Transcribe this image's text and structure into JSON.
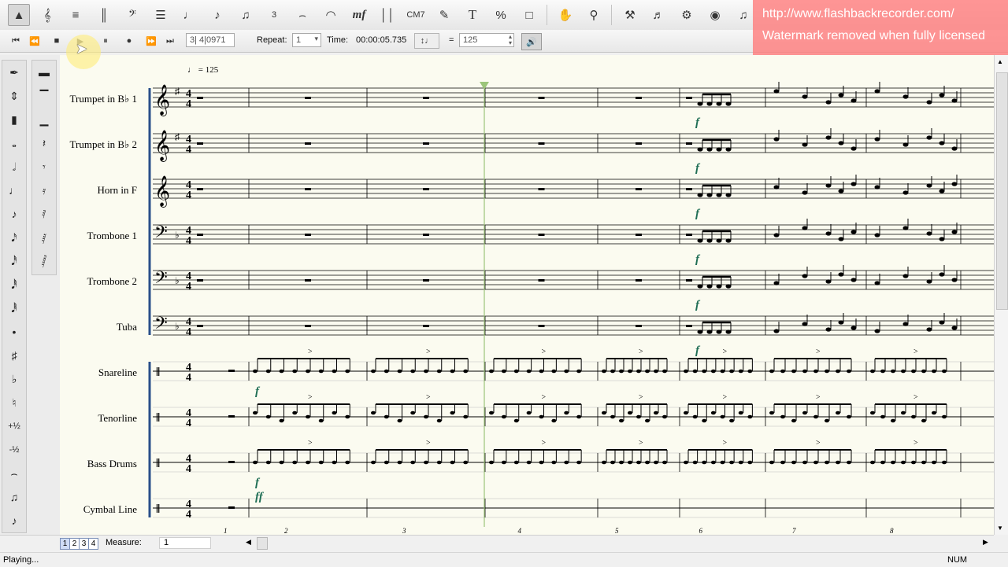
{
  "toolbar": {
    "tools": [
      "select-icon",
      "treble-clef-icon",
      "staff-icon",
      "barline-icon",
      "bass-clef-icon",
      "key-signature-icon",
      "note-icon",
      "eighth-note-icon",
      "multi-note-icon",
      "tuplet-icon",
      "slur-icon",
      "tie-icon",
      "dynamics-icon",
      "repeat-icon",
      "chord-symbol-icon",
      "lyric-icon",
      "text-icon",
      "percent-icon",
      "page-icon",
      "hand-icon",
      "zoom-icon",
      "wrench-icon",
      "playback-icon",
      "instrument-icon",
      "mixer-icon",
      "notes-icon"
    ],
    "labels": {
      "dynamics": "mf",
      "chord": "CM7",
      "text": "T",
      "percent": "%",
      "tuplet": "3"
    }
  },
  "watermark": {
    "line1": "http://www.flashbackrecorder.com/",
    "line2": "Watermark removed when fully licensed"
  },
  "transport": {
    "counter": "3| 4|0971",
    "repeat_label": "Repeat:",
    "repeat_value": "1",
    "time_label": "Time:",
    "time_value": "00:00:05.735",
    "tempo_equals": "=",
    "tempo_value": "125"
  },
  "score": {
    "tempo_mark": "♩ = 125",
    "staves": [
      {
        "name": "Trumpet in B♭ 1",
        "clef": "treble"
      },
      {
        "name": "Trumpet in B♭ 2",
        "clef": "treble"
      },
      {
        "name": "Horn in F",
        "clef": "treble"
      },
      {
        "name": "Trombone 1",
        "clef": "bass"
      },
      {
        "name": "Trombone 2",
        "clef": "bass"
      },
      {
        "name": "Tuba",
        "clef": "bass"
      },
      {
        "name": "Snareline",
        "clef": "perc"
      },
      {
        "name": "Tenorline",
        "clef": "perc"
      },
      {
        "name": "Bass Drums",
        "clef": "perc"
      },
      {
        "name": "Cymbal Line",
        "clef": "perc"
      }
    ],
    "time_signature": "4/4",
    "measure_numbers": [
      "1",
      "2",
      "3",
      "4",
      "5",
      "6",
      "7",
      "8"
    ],
    "dynamics": {
      "brass": "f",
      "drums": "f",
      "cymbal": "ff"
    }
  },
  "bottom": {
    "pages": [
      "1",
      "2",
      "3",
      "4"
    ],
    "measure_label": "Measure:",
    "measure_value": "1"
  },
  "status": {
    "text": "Playing...",
    "num": "NUM"
  }
}
